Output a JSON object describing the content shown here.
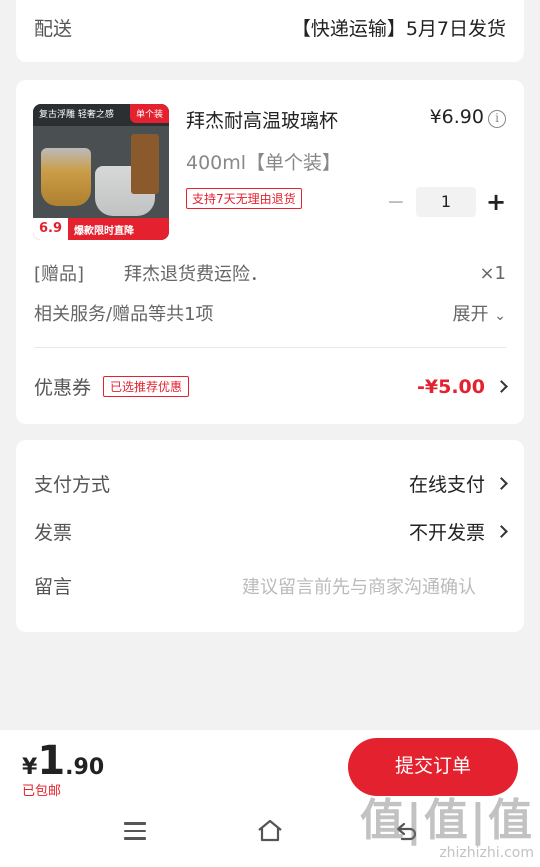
{
  "delivery": {
    "label": "配送",
    "value": "【快递运输】5月7日发货"
  },
  "product": {
    "title": "拜杰耐高温玻璃杯",
    "price": "¥6.90",
    "spec": "400ml【单个装】",
    "badge": "支持7天无理由退货",
    "quantity": "1",
    "image": {
      "banner": "复古浮雕 轻奢之感",
      "corner_tag": "单个装",
      "price": "6.9",
      "strip_text": "爆款限时直降"
    }
  },
  "gift": {
    "label": "[赠品]",
    "name": "拜杰退货费运险．",
    "count": "×1"
  },
  "services": {
    "label": "相关服务/赠品等共1项",
    "expand": "展开"
  },
  "coupon": {
    "label": "优惠券",
    "tag": "已选推荐优惠",
    "value": "-¥5.00"
  },
  "payment": {
    "method_label": "支付方式",
    "method_value": "在线支付",
    "invoice_label": "发票",
    "invoice_value": "不开发票",
    "message_label": "留言",
    "message_placeholder": "建议留言前先与商家沟通确认"
  },
  "footer": {
    "currency": "¥",
    "total_int": "1",
    "total_dec": ".90",
    "shipping": "已包邮",
    "submit": "提交订单"
  },
  "watermark": {
    "big": "值|值|值",
    "small": "zhizhizhi.com"
  },
  "colors": {
    "accent": "#e4222f",
    "bg": "#f2f2f2"
  }
}
